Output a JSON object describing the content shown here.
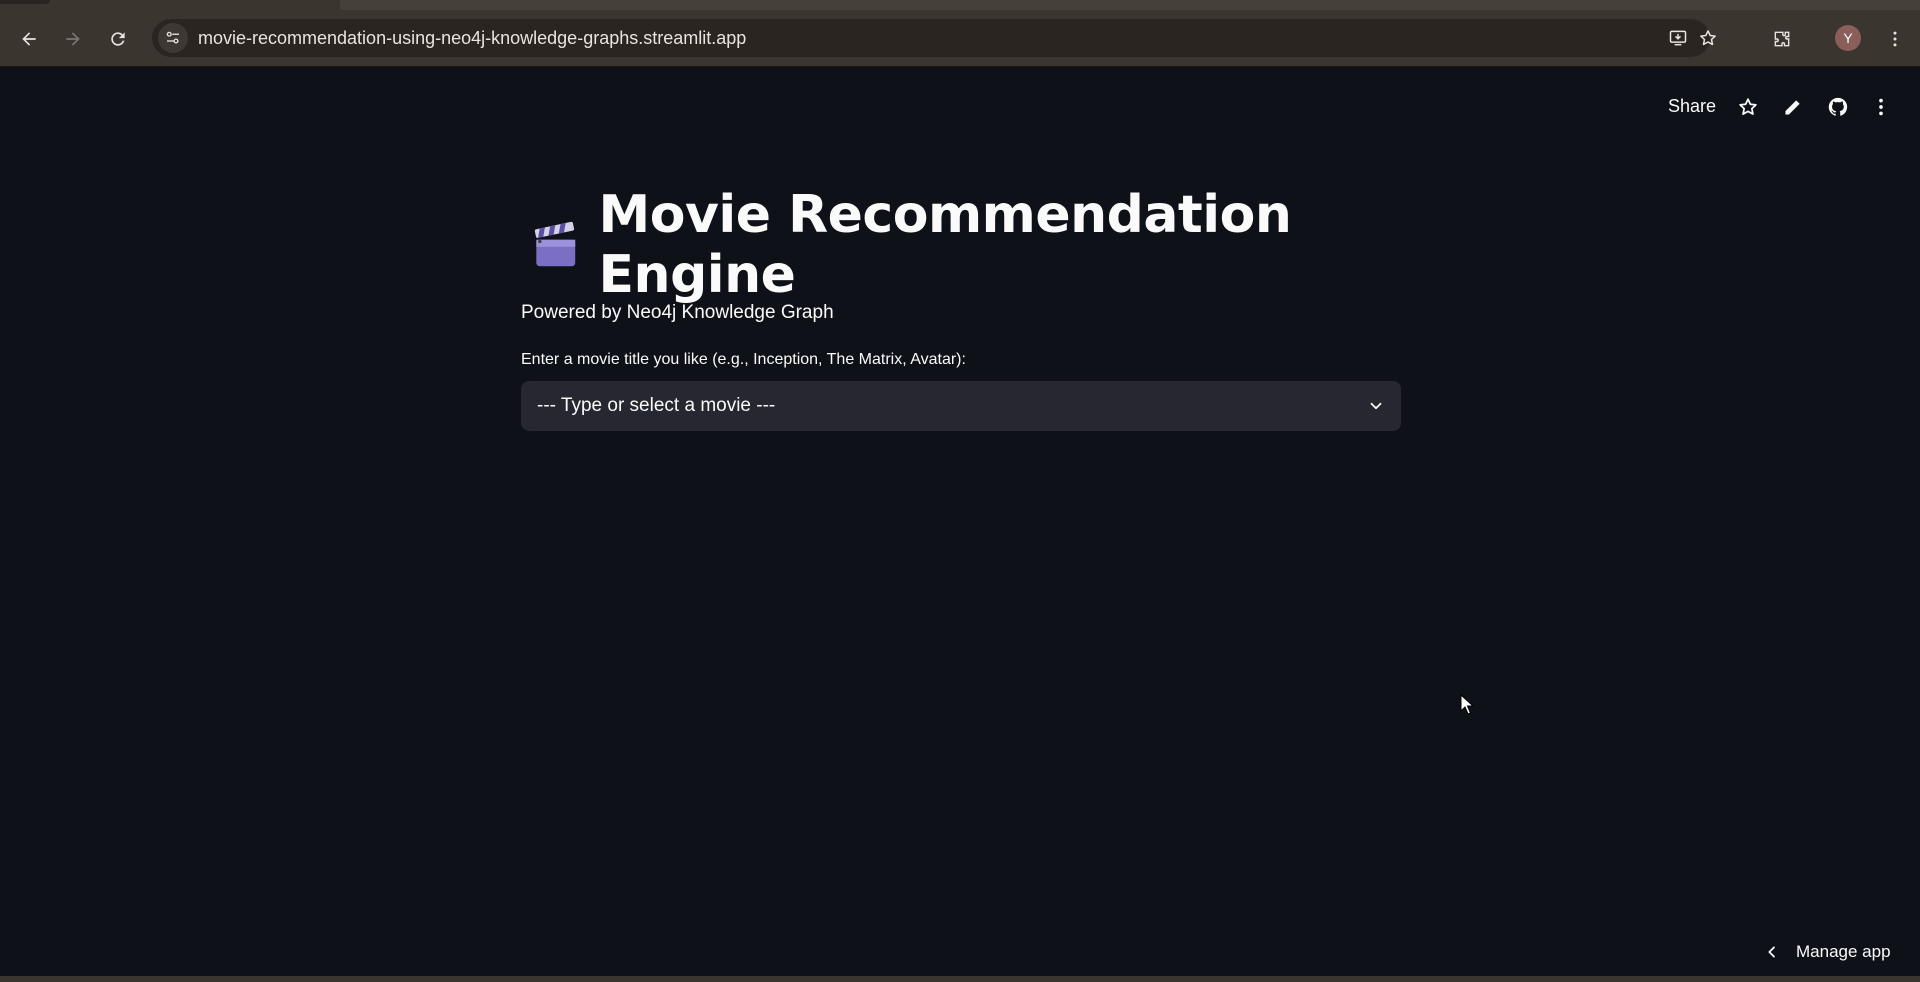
{
  "browser": {
    "url": "movie-recommendation-using-neo4j-knowledge-graphs.streamlit.app",
    "profile_initial": "Y"
  },
  "header": {
    "share_label": "Share"
  },
  "main": {
    "title_icon": "clapper-board-icon",
    "title": "Movie Recommendation Engine",
    "subtitle": "Powered by Neo4j Knowledge Graph",
    "input_label": "Enter a movie title you like (e.g., Inception, The Matrix, Avatar):",
    "select_placeholder": "--- Type or select a movie ---"
  },
  "footer": {
    "manage_app_label": "Manage app"
  },
  "colors": {
    "app_bg": "#0e1117",
    "input_bg": "#262730",
    "chrome_bg": "#3b3530",
    "text": "#fafafa"
  }
}
